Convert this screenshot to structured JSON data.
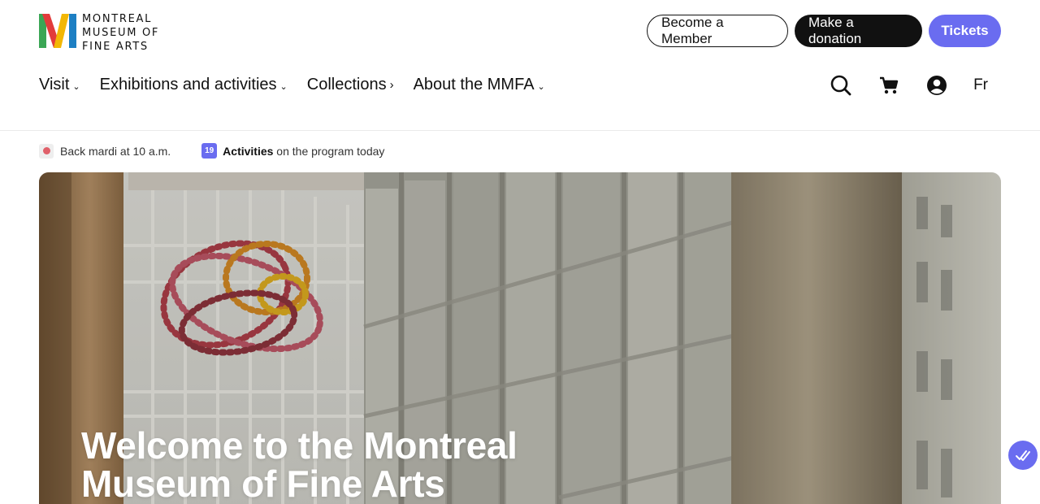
{
  "header": {
    "logo": {
      "mark": "M",
      "line1": "MONTREAL",
      "line2": "MUSEUM OF",
      "line3": "FINE ARTS"
    },
    "actions": {
      "member_label": "Become a Member",
      "donation_label": "Make a donation",
      "tickets_label": "Tickets"
    },
    "nav": [
      {
        "label": "Visit",
        "caret": "⌄"
      },
      {
        "label": "Exhibitions and activities",
        "caret": "⌄"
      },
      {
        "label": "Collections",
        "caret": "›"
      },
      {
        "label": "About the MMFA",
        "caret": "⌄"
      }
    ],
    "icons": [
      "search-icon",
      "cart-icon",
      "account-icon"
    ],
    "language_label": "Fr"
  },
  "info_strip": {
    "status_text": "Back mardi at 10 a.m.",
    "calendar_day": "19",
    "activities_bold": "Activities",
    "activities_rest": " on the program today"
  },
  "hero": {
    "title_line1": "Welcome to the Montreal",
    "title_line2": "Museum of Fine Arts"
  },
  "colors": {
    "accent": "#6a6cf0",
    "dark": "#111111",
    "status_dot": "#e0606a",
    "logo_green": "#3aa655",
    "logo_red": "#e23b3b",
    "logo_yellow": "#f2b705",
    "logo_blue": "#1d7fc3"
  }
}
